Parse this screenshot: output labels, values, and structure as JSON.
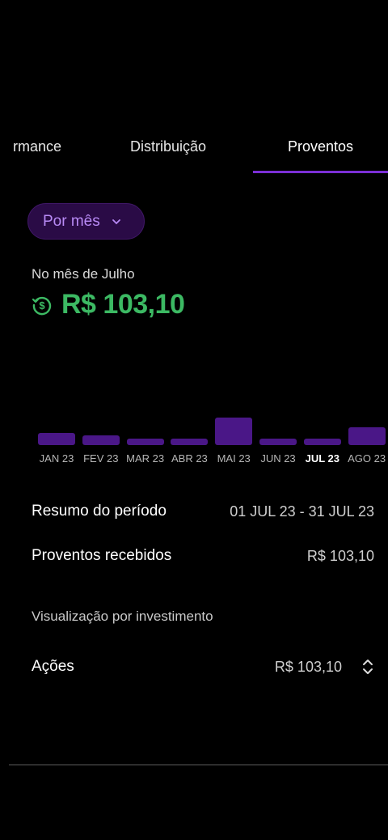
{
  "tabs": [
    {
      "label": "rmance"
    },
    {
      "label": "Distribuição"
    },
    {
      "label": "Proventos"
    }
  ],
  "period_button": {
    "label": "Por mês",
    "icon": "chevron-down-icon"
  },
  "month_label": "No mês de Julho",
  "total": {
    "amount": "R$ 103,10",
    "icon": "dollar-refresh-icon"
  },
  "colors": {
    "accent": "#7b2fd6",
    "bar": "#4a1787",
    "positive": "#3cb963"
  },
  "chart_data": {
    "type": "bar",
    "categories": [
      "JAN 23",
      "FEV 23",
      "MAR 23",
      "ABR 23",
      "MAI 23",
      "JUN 23",
      "JUL 23",
      "AGO 23"
    ],
    "values": [
      30,
      25,
      17,
      17,
      70,
      17,
      17,
      45
    ],
    "selected": "JUL 23"
  },
  "summary": {
    "title": "Resumo do período",
    "range": "01 JUL 23 - 31 JUL 23",
    "received_label": "Proventos recebidos",
    "received_value": "R$ 103,10"
  },
  "by_investment": {
    "section_label": "Visualização por investimento",
    "items": [
      {
        "label": "Ações",
        "value": "R$ 103,10",
        "icon": "expand-collapse-icon"
      }
    ]
  }
}
